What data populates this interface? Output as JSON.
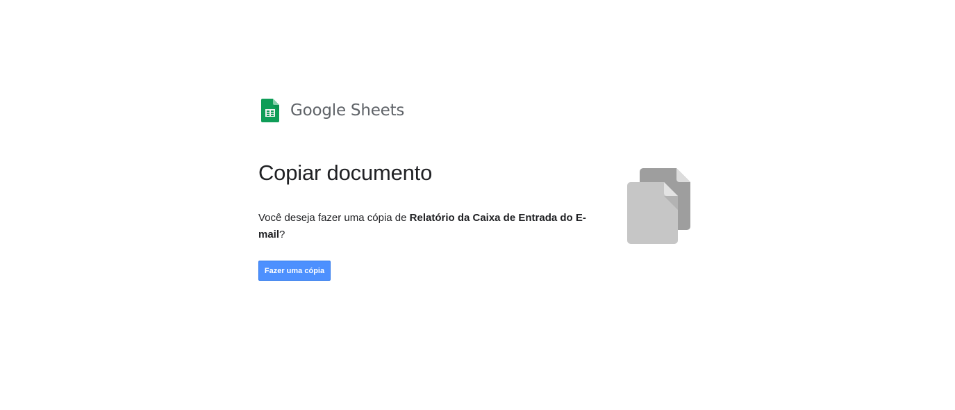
{
  "brand": {
    "company": "Google",
    "product": "Sheets",
    "logo_icon": "google-sheets-icon",
    "logo_color": "#0f9d58"
  },
  "page": {
    "title": "Copiar documento",
    "message_prefix": "Você deseja fazer uma cópia de ",
    "document_name": "Relatório da Caixa de Entrada do E-mail",
    "message_suffix": "?"
  },
  "actions": {
    "copy_button_label": "Fazer uma cópia",
    "button_color": "#4d90fe"
  },
  "illustration": {
    "icon": "copy-documents-icon",
    "back_color": "#9e9e9e",
    "front_color": "#c6c6c6"
  }
}
